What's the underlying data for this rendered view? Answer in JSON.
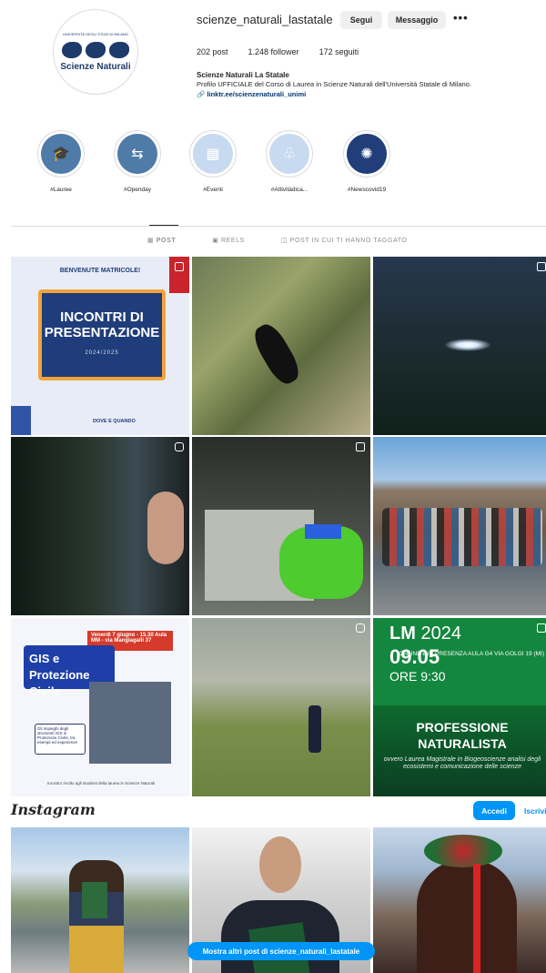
{
  "profile": {
    "username": "scienze_naturali_lastatale",
    "avatar_text": "Scienze Naturali",
    "avatar_small_text": "UNIVERSITÀ DEGLI STUDI DI MILANO",
    "follow_label": "Segui",
    "message_label": "Messaggio",
    "more_label": "•••",
    "posts_count": "202 post",
    "followers_count": "1.248 follower",
    "following_count": "172 seguiti",
    "bio_title": "Scienze Naturali La Statale",
    "bio_text": "Profilo UFFICIALE del Corso di Laurea in Scienze Naturali dell'Università Statale di Milano.",
    "bio_link": "linktr.ee/scienzenaturali_unimi"
  },
  "highlights": [
    {
      "label": "#Lauree",
      "icon": "graduation-cap-icon",
      "color": "#4e7ba8"
    },
    {
      "label": "#Openday",
      "icon": "signpost-icon",
      "color": "#4e7ba8"
    },
    {
      "label": "#Eventi",
      "icon": "calendar-icon",
      "color": "#c8daf0"
    },
    {
      "label": "#Attivitàdica...",
      "icon": "tree-icon",
      "color": "#c8daf0"
    },
    {
      "label": "#Newscovid19",
      "icon": "virus-icon",
      "color": "#213e7a"
    }
  ],
  "tabs": [
    {
      "label": "POST",
      "active": true
    },
    {
      "label": "REELS",
      "active": false
    },
    {
      "label": "POST IN CUI TI HANNO TAGGATO",
      "active": false
    }
  ],
  "posts": {
    "p1": {
      "top": "BENVENUTE MATRICOLE!",
      "headline": "INCONTRI DI PRESENTAZIONE",
      "year": "2024/2025",
      "bottom": "DOVE E QUANDO"
    },
    "p7": {
      "title": "GIS e Protezione Civile",
      "date": "Venerdì 7 giugno - 15.30 Aula MM - via Mangiagalli 37",
      "note": "Gli impieghi degli strumenti GIS in Protezione Civile, tra esempi ed esperienze",
      "footer": "Incontro rivolto agli studenti della laurea in Scienze Naturali"
    },
    "p9": {
      "lm": "LM",
      "year": "2024",
      "date": "09.05",
      "time": "ORE 9:30",
      "right": "ONLINE e IN PRESENZA AULA G4 VIA GOLGI 19 (MI)",
      "title": "PROFESSIONE NATURALISTA",
      "subtitle": "ovvero Laurea Magistrale in Biogeoscienze analisi degli ecosistemi e comunicazione delle scienze"
    }
  },
  "footer": {
    "logo": "Instagram",
    "login_label": "Accedi",
    "signup_label": "Iscriviti",
    "more_posts_label": "Mostra altri post di scienze_naturali_lastatale"
  }
}
